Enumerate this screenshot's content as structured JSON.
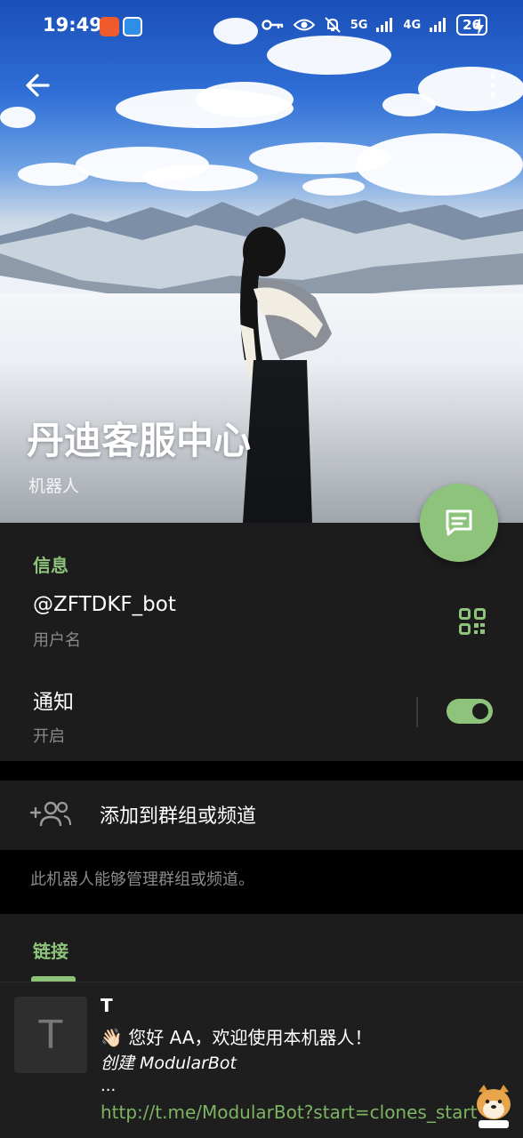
{
  "status_bar": {
    "time": "19:49",
    "network_1": "5G",
    "network_2": "4G",
    "battery": "26"
  },
  "profile": {
    "title": "丹迪客服中心",
    "subtitle": "机器人"
  },
  "info_section": {
    "header": "信息",
    "username_value": "@ZFTDKF_bot",
    "username_label": "用户名",
    "notify_value": "通知",
    "notify_label": "开启",
    "notify_enabled": true
  },
  "actions": {
    "add_to_group_label": "添加到群组或频道",
    "add_hint": "此机器人能够管理群组或频道。"
  },
  "links_section": {
    "header": "链接"
  },
  "pinned_preview": {
    "avatar_letter": "T",
    "sender": "T",
    "line1": "👋🏻 您好 AA，欢迎使用本机器人！",
    "line2": "创建 ModularBot",
    "line3": "...",
    "link": "http://t.me/ModularBot?start=clones_start"
  },
  "colors": {
    "accent": "#8ec37c",
    "surface": "#1c1c1c",
    "background": "#000000",
    "muted_text": "#8a8a8a"
  },
  "icons": [
    "back-arrow-icon",
    "more-vert-icon",
    "message-icon",
    "qr-code-icon",
    "add-group-icon",
    "app-icon-1",
    "app-icon-2",
    "key-icon",
    "eye-icon",
    "bell-mute-icon",
    "signal-icon",
    "charging-icon",
    "doge-sticker-icon"
  ]
}
